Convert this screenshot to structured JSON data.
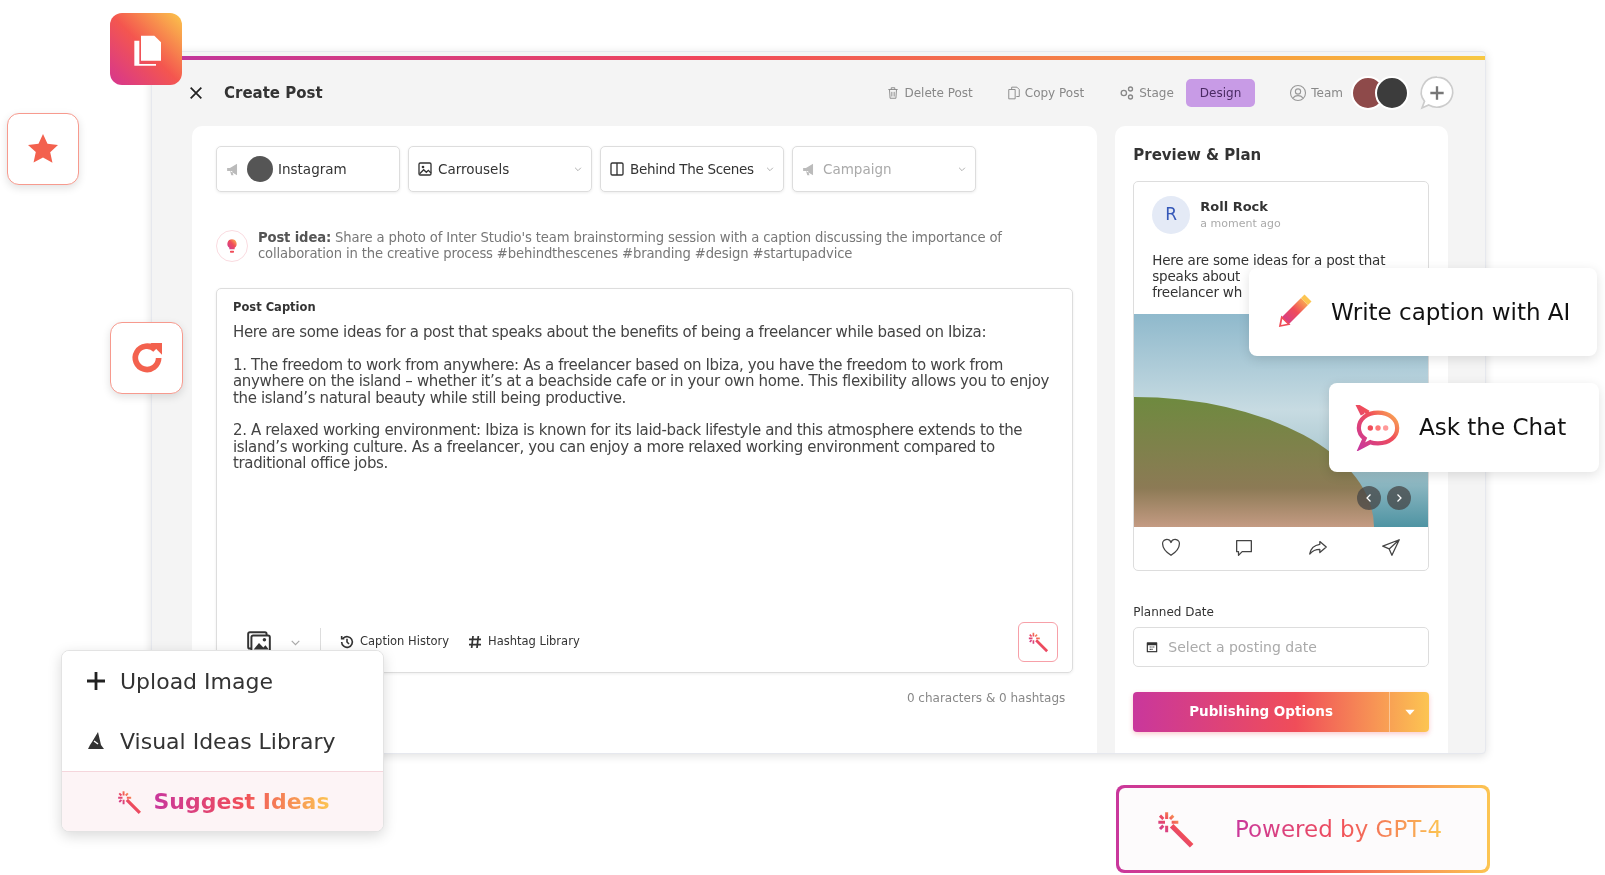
{
  "header": {
    "title": "Create Post",
    "actions": [
      {
        "label": "Delete Post",
        "kind": "delete"
      },
      {
        "label": "Copy Post",
        "kind": "copy"
      }
    ],
    "stage": {
      "label": "Stage",
      "value": "Design"
    },
    "team_label": "Team"
  },
  "selectors": [
    {
      "kind": "account",
      "label": "Instagram"
    },
    {
      "kind": "format",
      "label": "Carrousels"
    },
    {
      "kind": "category",
      "label": "Behind The Scenes"
    },
    {
      "kind": "campaign",
      "placeholder": "Campaign"
    }
  ],
  "post_idea": "**Post idea:** Share a photo of Inter Studio's team brainstorming session with a caption discussing the importance of collaboration in the creative process #behindthescenes #branding #design #startupadvice",
  "caption": {
    "label": "Post Caption",
    "paragraphs": [
      "Here are some ideas for a post that speaks about the benefits of being a freelancer while based on Ibiza:",
      "1. The freedom to work from anywhere: As a freelancer based on Ibiza, you have the freedom to work from anywhere on the island – whether it’s at a beachside cafe or in your own home. This flexibility allows you to enjoy the island’s natural beauty while still being productive.",
      "2. A relaxed working environment: Ibiza is known for its laid-back lifestyle and this atmosphere extends to the island’s working culture. As a freelancer, you can enjoy a more relaxed working environment compared to traditional office jobs."
    ]
  },
  "toolbar": [
    {
      "kind": "history",
      "label": "Caption History"
    },
    {
      "kind": "hashtag",
      "label": "Hashtag Library"
    }
  ],
  "counter": "0 characters & 0 hashtags",
  "preview": {
    "title": "Preview & Plan",
    "initial": "R",
    "author": "Roll Rock",
    "time": "a moment ago",
    "text_lines": [
      "Here are some ideas for a post that",
      "speaks about",
      "freelancer wh"
    ]
  },
  "planned_date": {
    "label": "Planned Date",
    "placeholder": "Select a posting date"
  },
  "publish_button": "Publishing Options",
  "callouts": [
    {
      "kind": "pencil",
      "label": "Write caption with AI"
    },
    {
      "kind": "chat",
      "label": "Ask the Chat"
    }
  ],
  "image_menu": [
    {
      "kind": "upload",
      "label": "Upload Image",
      "highlighted": false
    },
    {
      "kind": "library",
      "label": "Visual Ideas Library",
      "highlighted": false
    },
    {
      "kind": "suggest",
      "label": "Suggest Ideas",
      "highlighted": true
    }
  ],
  "powered_badge": "Powered by GPT-4"
}
